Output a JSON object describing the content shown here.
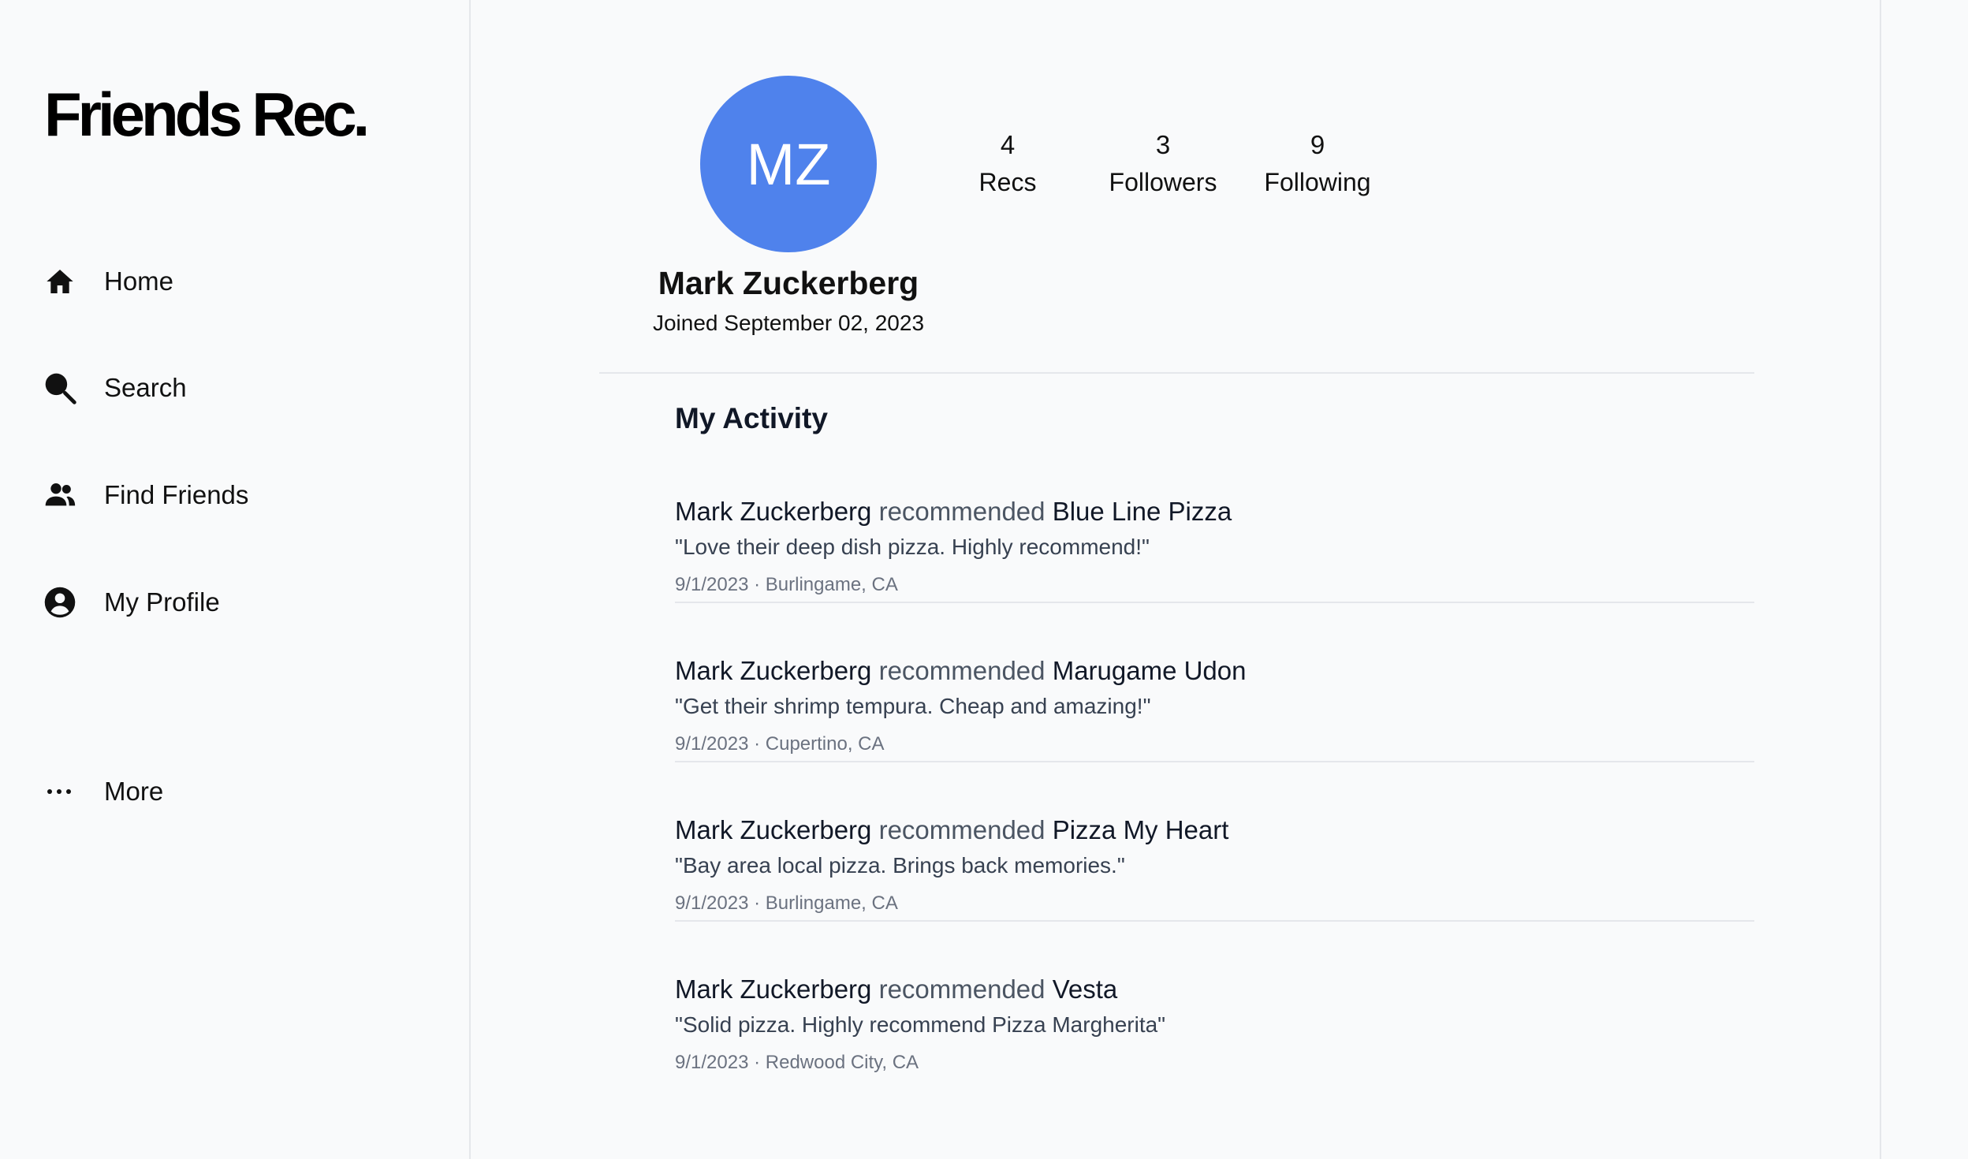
{
  "app": {
    "logo": "Friends Rec."
  },
  "sidebar": {
    "items": [
      {
        "label": "Home",
        "icon": "home-icon"
      },
      {
        "label": "Search",
        "icon": "search-icon"
      },
      {
        "label": "Find Friends",
        "icon": "people-icon"
      },
      {
        "label": "My Profile",
        "icon": "account-circle-icon"
      },
      {
        "label": "More",
        "icon": "more-horizontal-icon"
      }
    ]
  },
  "profile": {
    "initials": "MZ",
    "name": "Mark Zuckerberg",
    "joined": "Joined September 02, 2023",
    "avatar_color": "#4f82ec",
    "stats": [
      {
        "count": "4",
        "label": "Recs"
      },
      {
        "count": "3",
        "label": "Followers"
      },
      {
        "count": "9",
        "label": "Following"
      }
    ]
  },
  "activity": {
    "title": "My Activity",
    "items": [
      {
        "user": "Mark Zuckerberg",
        "verb": "recommended",
        "place": "Blue Line Pizza",
        "quote": "\"Love their deep dish pizza. Highly recommend!\"",
        "date": "9/1/2023",
        "location": "Burlingame, CA"
      },
      {
        "user": "Mark Zuckerberg",
        "verb": "recommended",
        "place": "Marugame Udon",
        "quote": "\"Get their shrimp tempura. Cheap and amazing!\"",
        "date": "9/1/2023",
        "location": "Cupertino, CA"
      },
      {
        "user": "Mark Zuckerberg",
        "verb": "recommended",
        "place": "Pizza My Heart",
        "quote": "\"Bay area local pizza. Brings back memories.\"",
        "date": "9/1/2023",
        "location": "Burlingame, CA"
      },
      {
        "user": "Mark Zuckerberg",
        "verb": "recommended",
        "place": "Vesta",
        "quote": "\"Solid pizza. Highly recommend Pizza Margherita\"",
        "date": "9/1/2023",
        "location": "Redwood City, CA"
      }
    ],
    "meta_separator": "·"
  }
}
